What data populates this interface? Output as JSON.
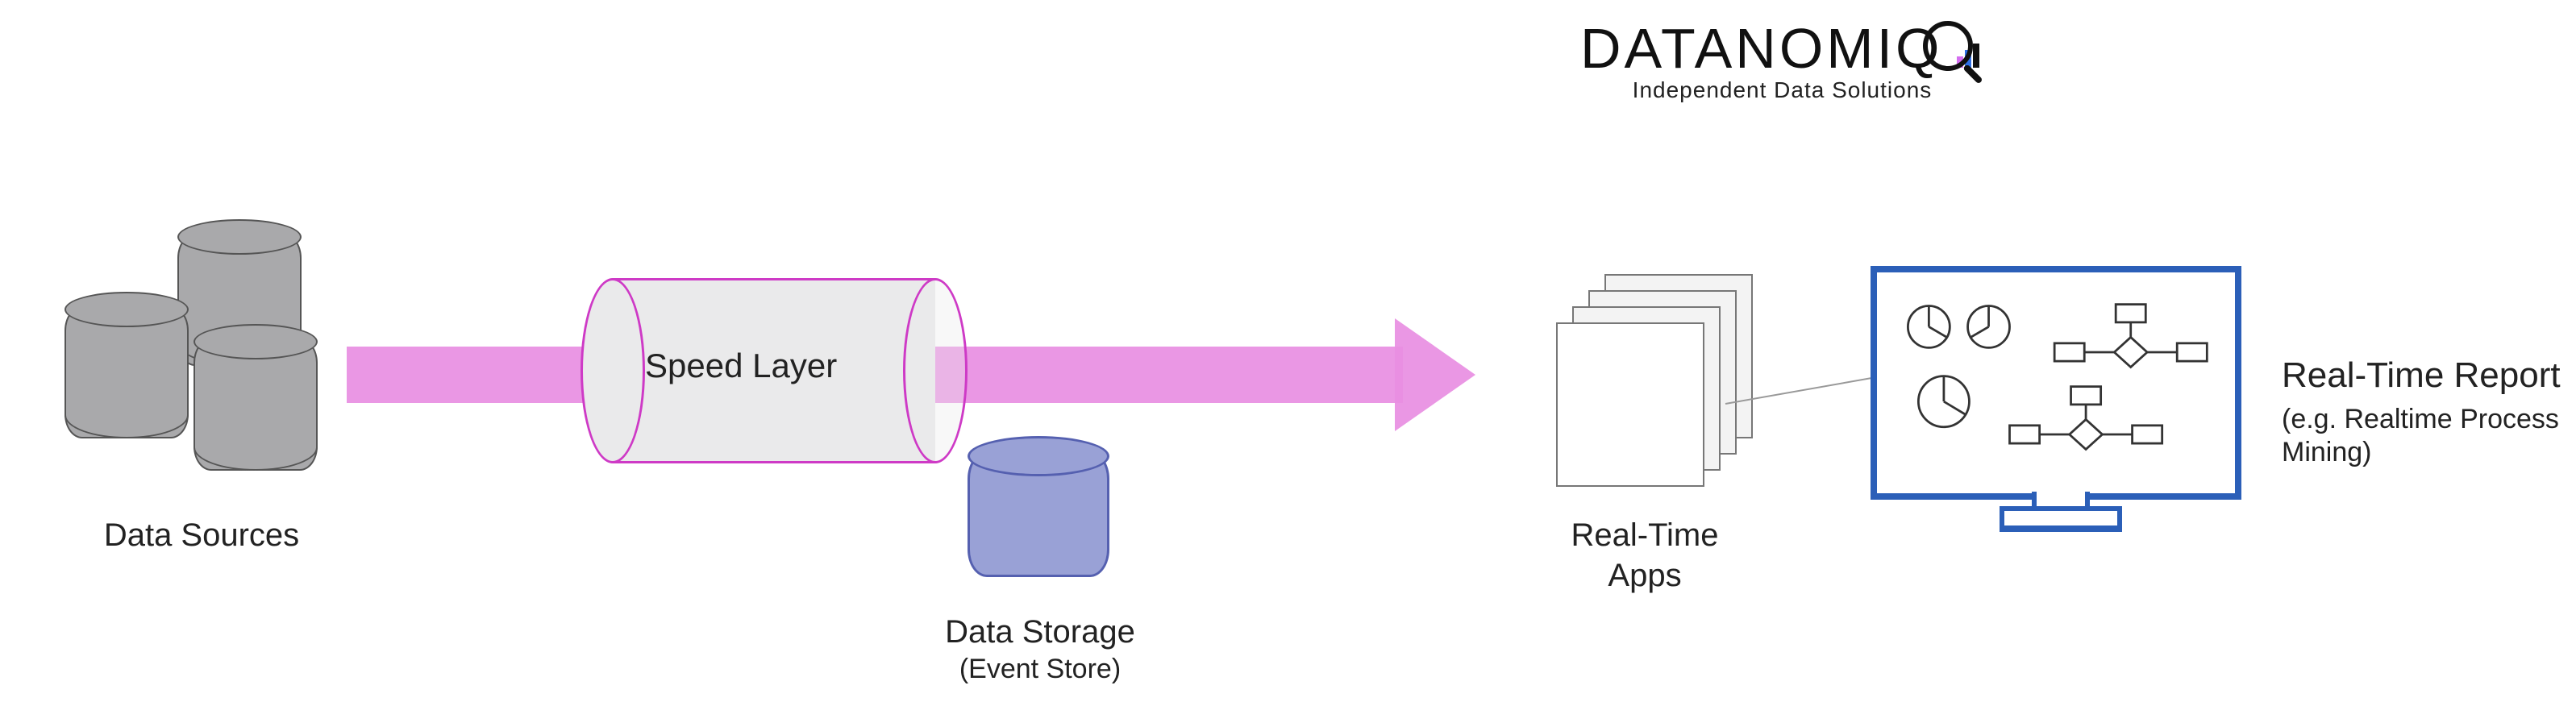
{
  "logo": {
    "brand": "DATANOMIQ",
    "tagline": "Independent Data Solutions"
  },
  "nodes": {
    "data_sources": {
      "label": "Data Sources"
    },
    "speed_layer": {
      "label": "Speed Layer"
    },
    "data_storage": {
      "label": "Data Storage",
      "sublabel": "(Event Store)"
    },
    "realtime_apps": {
      "label": "Real-Time",
      "label2": "Apps"
    },
    "realtime_report": {
      "label": "Real-Time Report",
      "sublabel": "(e.g. Realtime Process Mining)"
    }
  },
  "flow": [
    "Data Sources",
    "Speed Layer",
    "Data Storage (Event Store)",
    "Real-Time Apps",
    "Real-Time Report"
  ],
  "colors": {
    "arrow": "#e88ee2",
    "speed_outline": "#ce3ac6",
    "storage_fill": "#99a1d6",
    "storage_outline": "#5560b0",
    "monitor_outline": "#2b5fb8",
    "db_fill": "#a9a9ab"
  }
}
